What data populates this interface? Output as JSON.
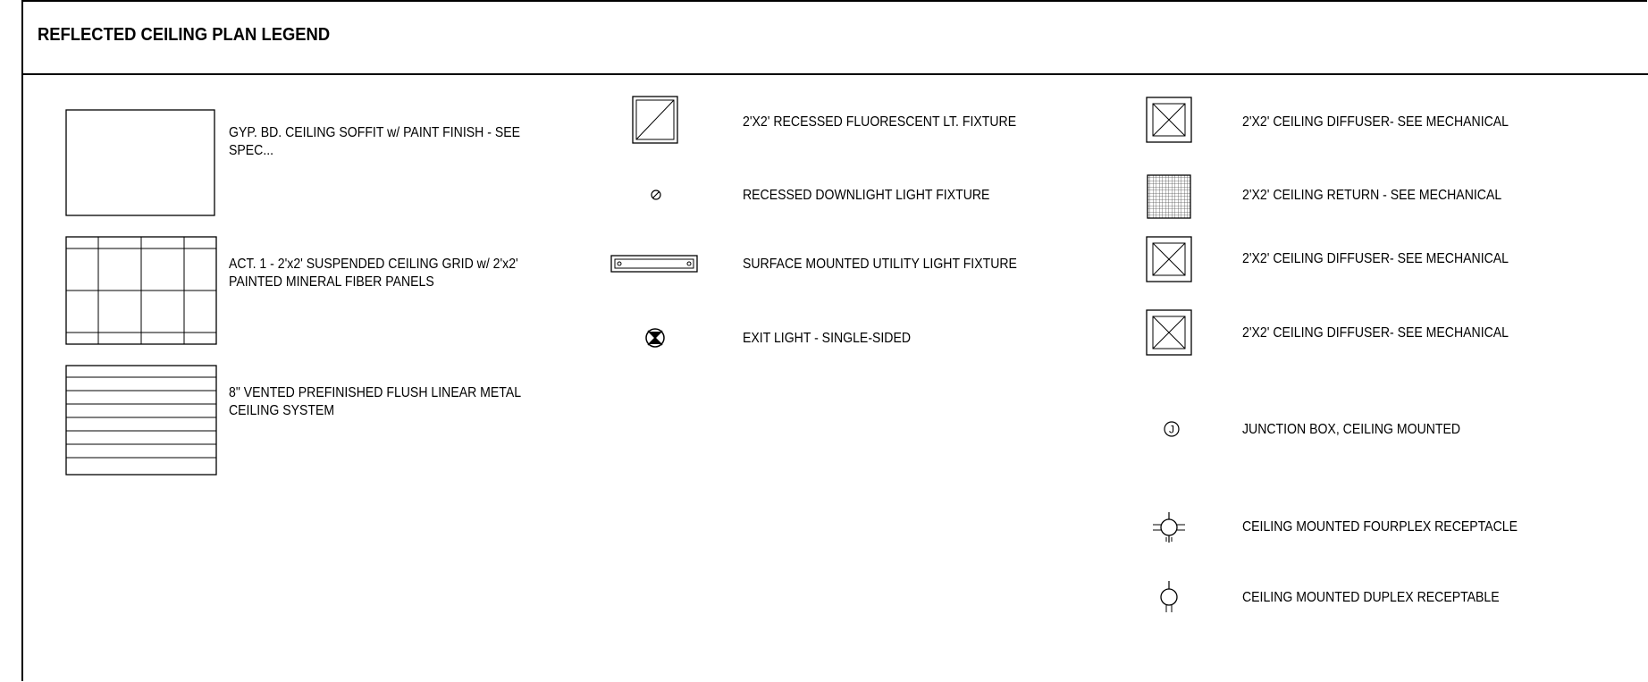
{
  "legend": {
    "title": "REFLECTED CEILING PLAN LEGEND",
    "col1": [
      {
        "symbol": "gyp-soffit-icon",
        "label_lines": [
          "GYP. BD. CEILING SOFFIT w/ PAINT FINISH - SEE",
          "SPEC..."
        ]
      },
      {
        "symbol": "act-grid-icon",
        "label_lines": [
          "ACT. 1 - 2'x2' SUSPENDED CEILING GRID w/ 2'x2'",
          "PAINTED MINERAL FIBER PANELS"
        ]
      },
      {
        "symbol": "linear-metal-ceiling-icon",
        "label_lines": [
          "8\" VENTED PREFINISHED FLUSH LINEAR METAL",
          "CEILING SYSTEM"
        ]
      }
    ],
    "col2": [
      {
        "symbol": "recessed-fluorescent-icon",
        "label": "2'X2' RECESSED FLUORESCENT LT. FIXTURE"
      },
      {
        "symbol": "downlight-icon",
        "label": "RECESSED DOWNLIGHT LIGHT FIXTURE"
      },
      {
        "symbol": "utility-light-icon",
        "label": "SURFACE MOUNTED UTILITY LIGHT FIXTURE"
      },
      {
        "symbol": "exit-light-icon",
        "label": "EXIT LIGHT - SINGLE-SIDED"
      }
    ],
    "col3": [
      {
        "symbol": "ceiling-diffuser-icon",
        "label": "2'X2' CEILING DIFFUSER-  SEE MECHANICAL"
      },
      {
        "symbol": "ceiling-return-icon",
        "label": "2'X2' CEILING RETURN - SEE MECHANICAL"
      },
      {
        "symbol": "ceiling-diffuser-icon",
        "label": "2'X2' CEILING DIFFUSER-  SEE MECHANICAL"
      },
      {
        "symbol": "ceiling-diffuser-icon",
        "label": "2'X2' CEILING DIFFUSER-  SEE MECHANICAL"
      },
      {
        "symbol": "junction-box-icon",
        "label": "JUNCTION BOX, CEILING MOUNTED",
        "glyph": "J"
      },
      {
        "symbol": "fourplex-receptacle-icon",
        "label": "CEILING MOUNTED FOURPLEX RECEPTACLE"
      },
      {
        "symbol": "duplex-receptacle-icon",
        "label": "CEILING MOUNTED DUPLEX RECEPTABLE"
      }
    ]
  }
}
